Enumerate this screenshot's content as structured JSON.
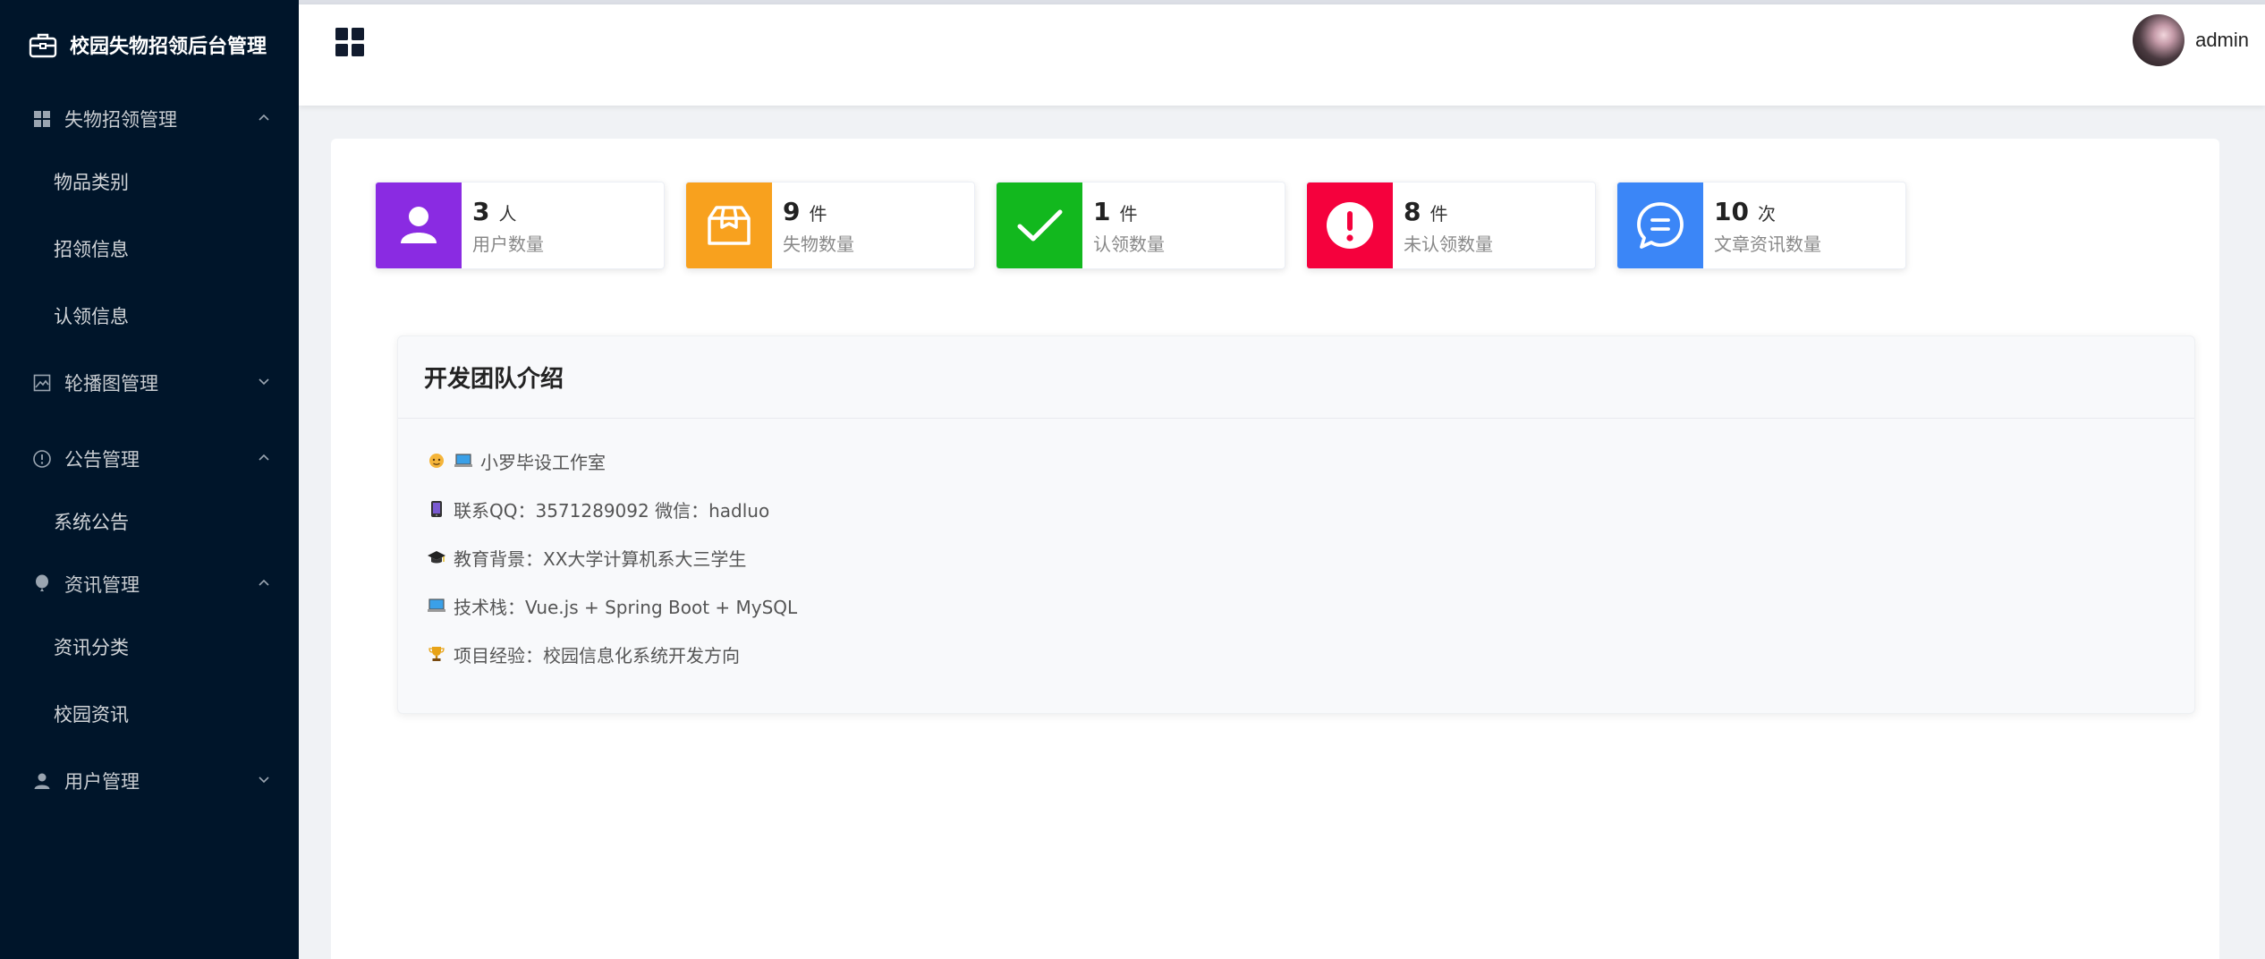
{
  "app": {
    "title": "校园失物招领后台管理"
  },
  "sidebar": {
    "groups": [
      {
        "label": "失物招领管理",
        "icon": "grid-icon",
        "expanded": true,
        "items": [
          {
            "label": "物品类别"
          },
          {
            "label": "招领信息"
          },
          {
            "label": "认领信息"
          }
        ]
      },
      {
        "label": "轮播图管理",
        "icon": "image-icon",
        "expanded": false,
        "items": []
      },
      {
        "label": "公告管理",
        "icon": "info-circle-icon",
        "expanded": true,
        "items": [
          {
            "label": "系统公告"
          }
        ]
      },
      {
        "label": "资讯管理",
        "icon": "balloon-icon",
        "expanded": true,
        "items": [
          {
            "label": "资讯分类"
          },
          {
            "label": "校园资讯"
          }
        ]
      },
      {
        "label": "用户管理",
        "icon": "user-icon",
        "expanded": false,
        "items": []
      }
    ]
  },
  "header": {
    "username": "admin"
  },
  "stats": [
    {
      "value": "3",
      "unit": "人",
      "label": "用户数量",
      "color": "#8a2be2",
      "icon": "user-icon"
    },
    {
      "value": "9",
      "unit": "件",
      "label": "失物数量",
      "color": "#f8a11e",
      "icon": "box-icon"
    },
    {
      "value": "1",
      "unit": "件",
      "label": "认领数量",
      "color": "#12b81e",
      "icon": "check-icon"
    },
    {
      "value": "8",
      "unit": "件",
      "label": "未认领数量",
      "color": "#f5013d",
      "icon": "alert-icon"
    },
    {
      "value": "10",
      "unit": "次",
      "label": "文章资讯数量",
      "color": "#3b86f7",
      "icon": "chat-icon"
    }
  ],
  "team": {
    "title": "开发团队介绍",
    "lines": [
      {
        "text": "小罗毕设工作室",
        "icons": [
          "person-emoji",
          "laptop-emoji"
        ]
      },
      {
        "text": "联系QQ：3571289092 微信：hadluo",
        "icons": [
          "phone-emoji"
        ]
      },
      {
        "text": "教育背景：XX大学计算机系大三学生",
        "icons": [
          "graduation-cap-emoji"
        ]
      },
      {
        "text": "技术栈：Vue.js + Spring Boot + MySQL",
        "icons": [
          "laptop-emoji"
        ]
      },
      {
        "text": "项目经验：校园信息化系统开发方向",
        "icons": [
          "trophy-emoji"
        ]
      }
    ]
  }
}
